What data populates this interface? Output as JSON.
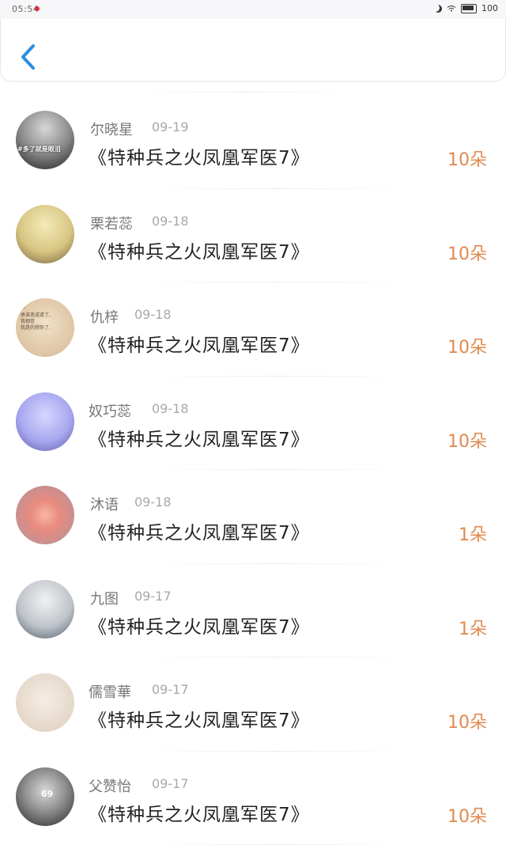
{
  "status_bar": {
    "time": "05:54",
    "battery": "100"
  },
  "header": {},
  "gifts": [
    {
      "name": "尔晓星",
      "date": "09-19",
      "title": "《特种兵之火凤凰军医7》",
      "amount": "10朵",
      "avatar_text": "#多了就是眼泪"
    },
    {
      "name": "栗若蕊",
      "date": "09-18",
      "title": "《特种兵之火凤凰军医7》",
      "amount": "10朵"
    },
    {
      "name": "仇梓",
      "date": "09-18",
      "title": "《特种兵之火凤凰军医7》",
      "amount": "10朵",
      "avatar_text": "一\n承诺变成谎了,\n我相信\n我是的想你了."
    },
    {
      "name": "奴巧蕊",
      "date": "09-18",
      "title": "《特种兵之火凤凰军医7》",
      "amount": "10朵"
    },
    {
      "name": "沐语",
      "date": "09-18",
      "title": "《特种兵之火凤凰军医7》",
      "amount": "1朵"
    },
    {
      "name": "九图",
      "date": "09-17",
      "title": "《特种兵之火凤凰军医7》",
      "amount": "1朵"
    },
    {
      "name": "儒雪華",
      "date": "09-17",
      "title": "《特种兵之火凤凰军医7》",
      "amount": "10朵"
    },
    {
      "name": "父赞怡",
      "date": "09-17",
      "title": "《特种兵之火凤凰军医7》",
      "amount": "10朵",
      "avatar_text": "69"
    }
  ]
}
